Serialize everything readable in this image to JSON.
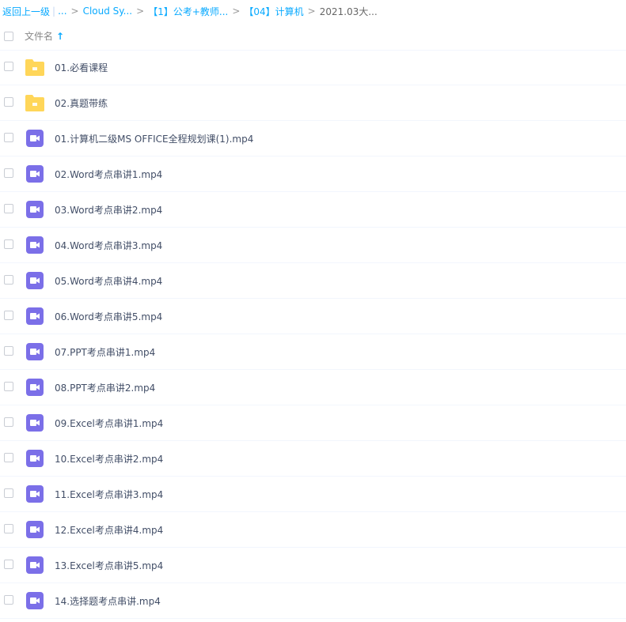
{
  "breadcrumb": {
    "back_label": "返回上一级",
    "ellipsis": "...",
    "items": [
      "Cloud Sy...",
      "【1】公考+教师...",
      "【04】计算机"
    ],
    "current": "2021.03大...",
    "separator": ">",
    "divider": "|"
  },
  "header": {
    "column_label": "文件名",
    "sort_icon": "arrow-up-icon",
    "sort_glyph": "↑"
  },
  "colors": {
    "link": "#09aaff",
    "folder": "#ffd659",
    "video": "#7b6fe8"
  },
  "files": [
    {
      "name": "01.必看课程",
      "type": "folder"
    },
    {
      "name": "02.真题带练",
      "type": "folder"
    },
    {
      "name": "01.计算机二级MS OFFICE全程规划课(1).mp4",
      "type": "video"
    },
    {
      "name": "02.Word考点串讲1.mp4",
      "type": "video"
    },
    {
      "name": "03.Word考点串讲2.mp4",
      "type": "video"
    },
    {
      "name": "04.Word考点串讲3.mp4",
      "type": "video"
    },
    {
      "name": "05.Word考点串讲4.mp4",
      "type": "video"
    },
    {
      "name": "06.Word考点串讲5.mp4",
      "type": "video"
    },
    {
      "name": "07.PPT考点串讲1.mp4",
      "type": "video"
    },
    {
      "name": "08.PPT考点串讲2.mp4",
      "type": "video"
    },
    {
      "name": "09.Excel考点串讲1.mp4",
      "type": "video"
    },
    {
      "name": "10.Excel考点串讲2.mp4",
      "type": "video"
    },
    {
      "name": "11.Excel考点串讲3.mp4",
      "type": "video"
    },
    {
      "name": "12.Excel考点串讲4.mp4",
      "type": "video"
    },
    {
      "name": "13.Excel考点串讲5.mp4",
      "type": "video"
    },
    {
      "name": "14.选择题考点串讲.mp4",
      "type": "video"
    }
  ]
}
